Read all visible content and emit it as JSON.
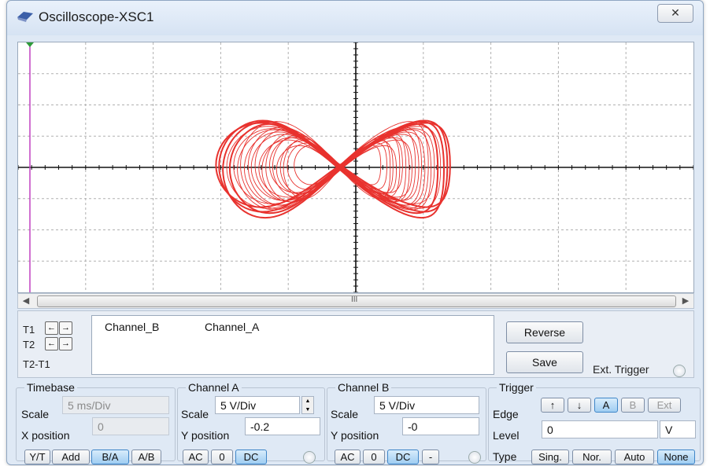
{
  "window": {
    "title": "Oscilloscope-XSC1",
    "close_label": "✕"
  },
  "trace_color": "#e8322e",
  "grid_color": "#b0b0b0",
  "scrollbar": {
    "grip": "III"
  },
  "cursors": {
    "t1_label": "T1",
    "t2_label": "T2",
    "t2_t1_label": "T2-T1",
    "left_arrow": "←",
    "right_arrow": "→",
    "columns": [
      "Channel_B",
      "Channel_A"
    ]
  },
  "buttons": {
    "reverse": "Reverse",
    "save": "Save"
  },
  "ext_trigger_label": "Ext. Trigger",
  "timebase": {
    "title": "Timebase",
    "scale_label": "Scale",
    "scale_value": "5 ms/Div",
    "xpos_label": "X position",
    "xpos_value": "0",
    "modes": [
      "Y/T",
      "Add",
      "B/A",
      "A/B"
    ],
    "active_mode": "B/A"
  },
  "channel_a": {
    "title": "Channel A",
    "scale_label": "Scale",
    "scale_value": "5  V/Div",
    "ypos_label": "Y position",
    "ypos_value": "-0.2",
    "coupling": [
      "AC",
      "0",
      "DC"
    ],
    "active": "DC"
  },
  "channel_b": {
    "title": "Channel B",
    "scale_label": "Scale",
    "scale_value": "5  V/Div",
    "ypos_label": "Y position",
    "ypos_value": "-0",
    "coupling": [
      "AC",
      "0",
      "DC",
      "-"
    ],
    "active": "DC"
  },
  "trigger": {
    "title": "Trigger",
    "edge_label": "Edge",
    "edge_buttons": [
      "↑",
      "↓",
      "A",
      "B",
      "Ext"
    ],
    "active_edge": "A",
    "level_label": "Level",
    "level_value": "0",
    "level_unit": "V",
    "type_label": "Type",
    "types": [
      "Sing.",
      "Nor.",
      "Auto",
      "None"
    ],
    "active_type": "None"
  }
}
